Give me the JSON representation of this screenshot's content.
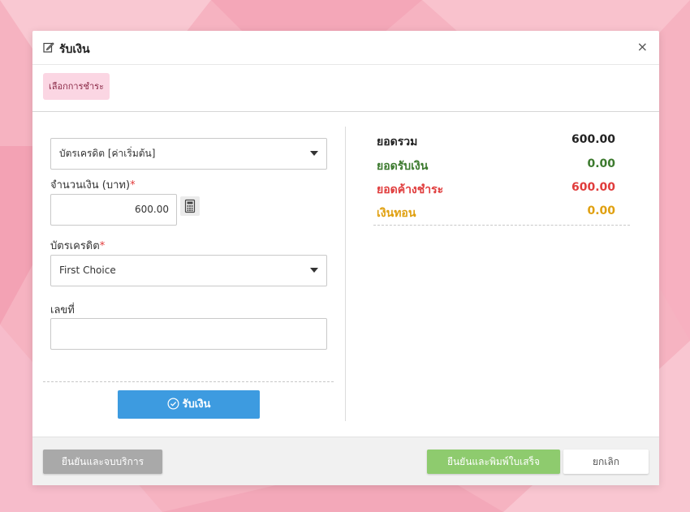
{
  "dialog": {
    "title": "รับเงิน",
    "close_symbol": "×"
  },
  "tabs": [
    {
      "label": "เลือกการชำระ"
    }
  ],
  "form": {
    "payment_type": {
      "selected": "บัตรเครดิต [ค่าเริ่มต้น]"
    },
    "amount": {
      "label": "จำนวนเงิน (บาท)",
      "required_mark": "*",
      "value": "600.00"
    },
    "card": {
      "label": "บัตรเครดิต",
      "required_mark": "*",
      "selected": "First Choice"
    },
    "number": {
      "label": "เลขที่",
      "value": ""
    },
    "receive_button": {
      "label": "รับเงิน"
    }
  },
  "summary": [
    {
      "label": "ยอดรวม",
      "value": "600.00",
      "color": "#222222"
    },
    {
      "label": "ยอดรับเงิน",
      "value": "0.00",
      "color": "#3c7a2e"
    },
    {
      "label": "ยอดค้างชำระ",
      "value": "600.00",
      "color": "#e03c3c"
    },
    {
      "label": "เงินทอน",
      "value": "0.00",
      "color": "#e0a010"
    }
  ],
  "footer": {
    "confirm_finish": "ยืนยันและจบบริการ",
    "confirm_print": "ยืนยันและพิมพ์ใบเสร็จ",
    "cancel": "ยกเลิก"
  },
  "colors": {
    "primary": "#3d9be0",
    "success": "#8ecb6e",
    "tab_bg": "#fbd6e3",
    "background": "#f7b8c4"
  },
  "icons": {
    "edit": "edit-icon",
    "close": "close-icon",
    "calculator": "calculator-icon",
    "check": "check-circle-icon",
    "dropdown": "chevron-down-icon"
  }
}
